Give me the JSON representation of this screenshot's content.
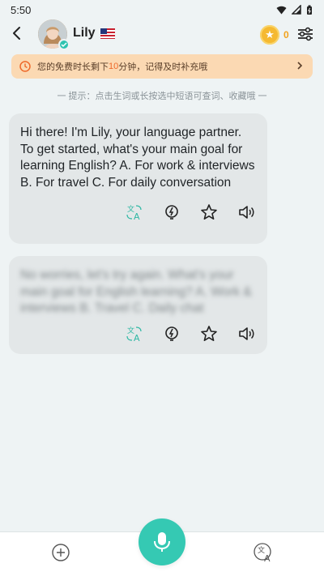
{
  "status": {
    "time": "5:50"
  },
  "header": {
    "name": "Lily",
    "coins": "0"
  },
  "notice": {
    "text_before": "您的免费时长剩下",
    "highlight": "10",
    "text_after": "分钟，记得及时补充哦"
  },
  "tip": {
    "text": "一 提示：点击生词或长按选中短语可查词、收藏哦 一"
  },
  "messages": [
    {
      "text": "Hi there! I'm Lily, your language partner. To get started, what's your main goal for learning English? A. For work & interviews B. For travel C. For daily conversation"
    },
    {
      "text": "No worries, let's try again. What's your main goal for English learning? A. Work & interviews B. Travel C. Daily chat"
    }
  ],
  "icons": {
    "back": "back-arrow-icon",
    "settings": "sliders-icon",
    "coin": "coin-icon",
    "clock": "clock-icon",
    "translate": "translate-icon",
    "hint": "lightbulb-icon",
    "favorite": "star-icon",
    "speaker": "speaker-icon",
    "mic": "microphone-icon",
    "plus": "plus-icon"
  },
  "colors": {
    "accent": "#35c9b3",
    "notice_bg": "#fbd9b3",
    "notice_highlight": "#ee6a2b",
    "coin": "#f5b931"
  }
}
